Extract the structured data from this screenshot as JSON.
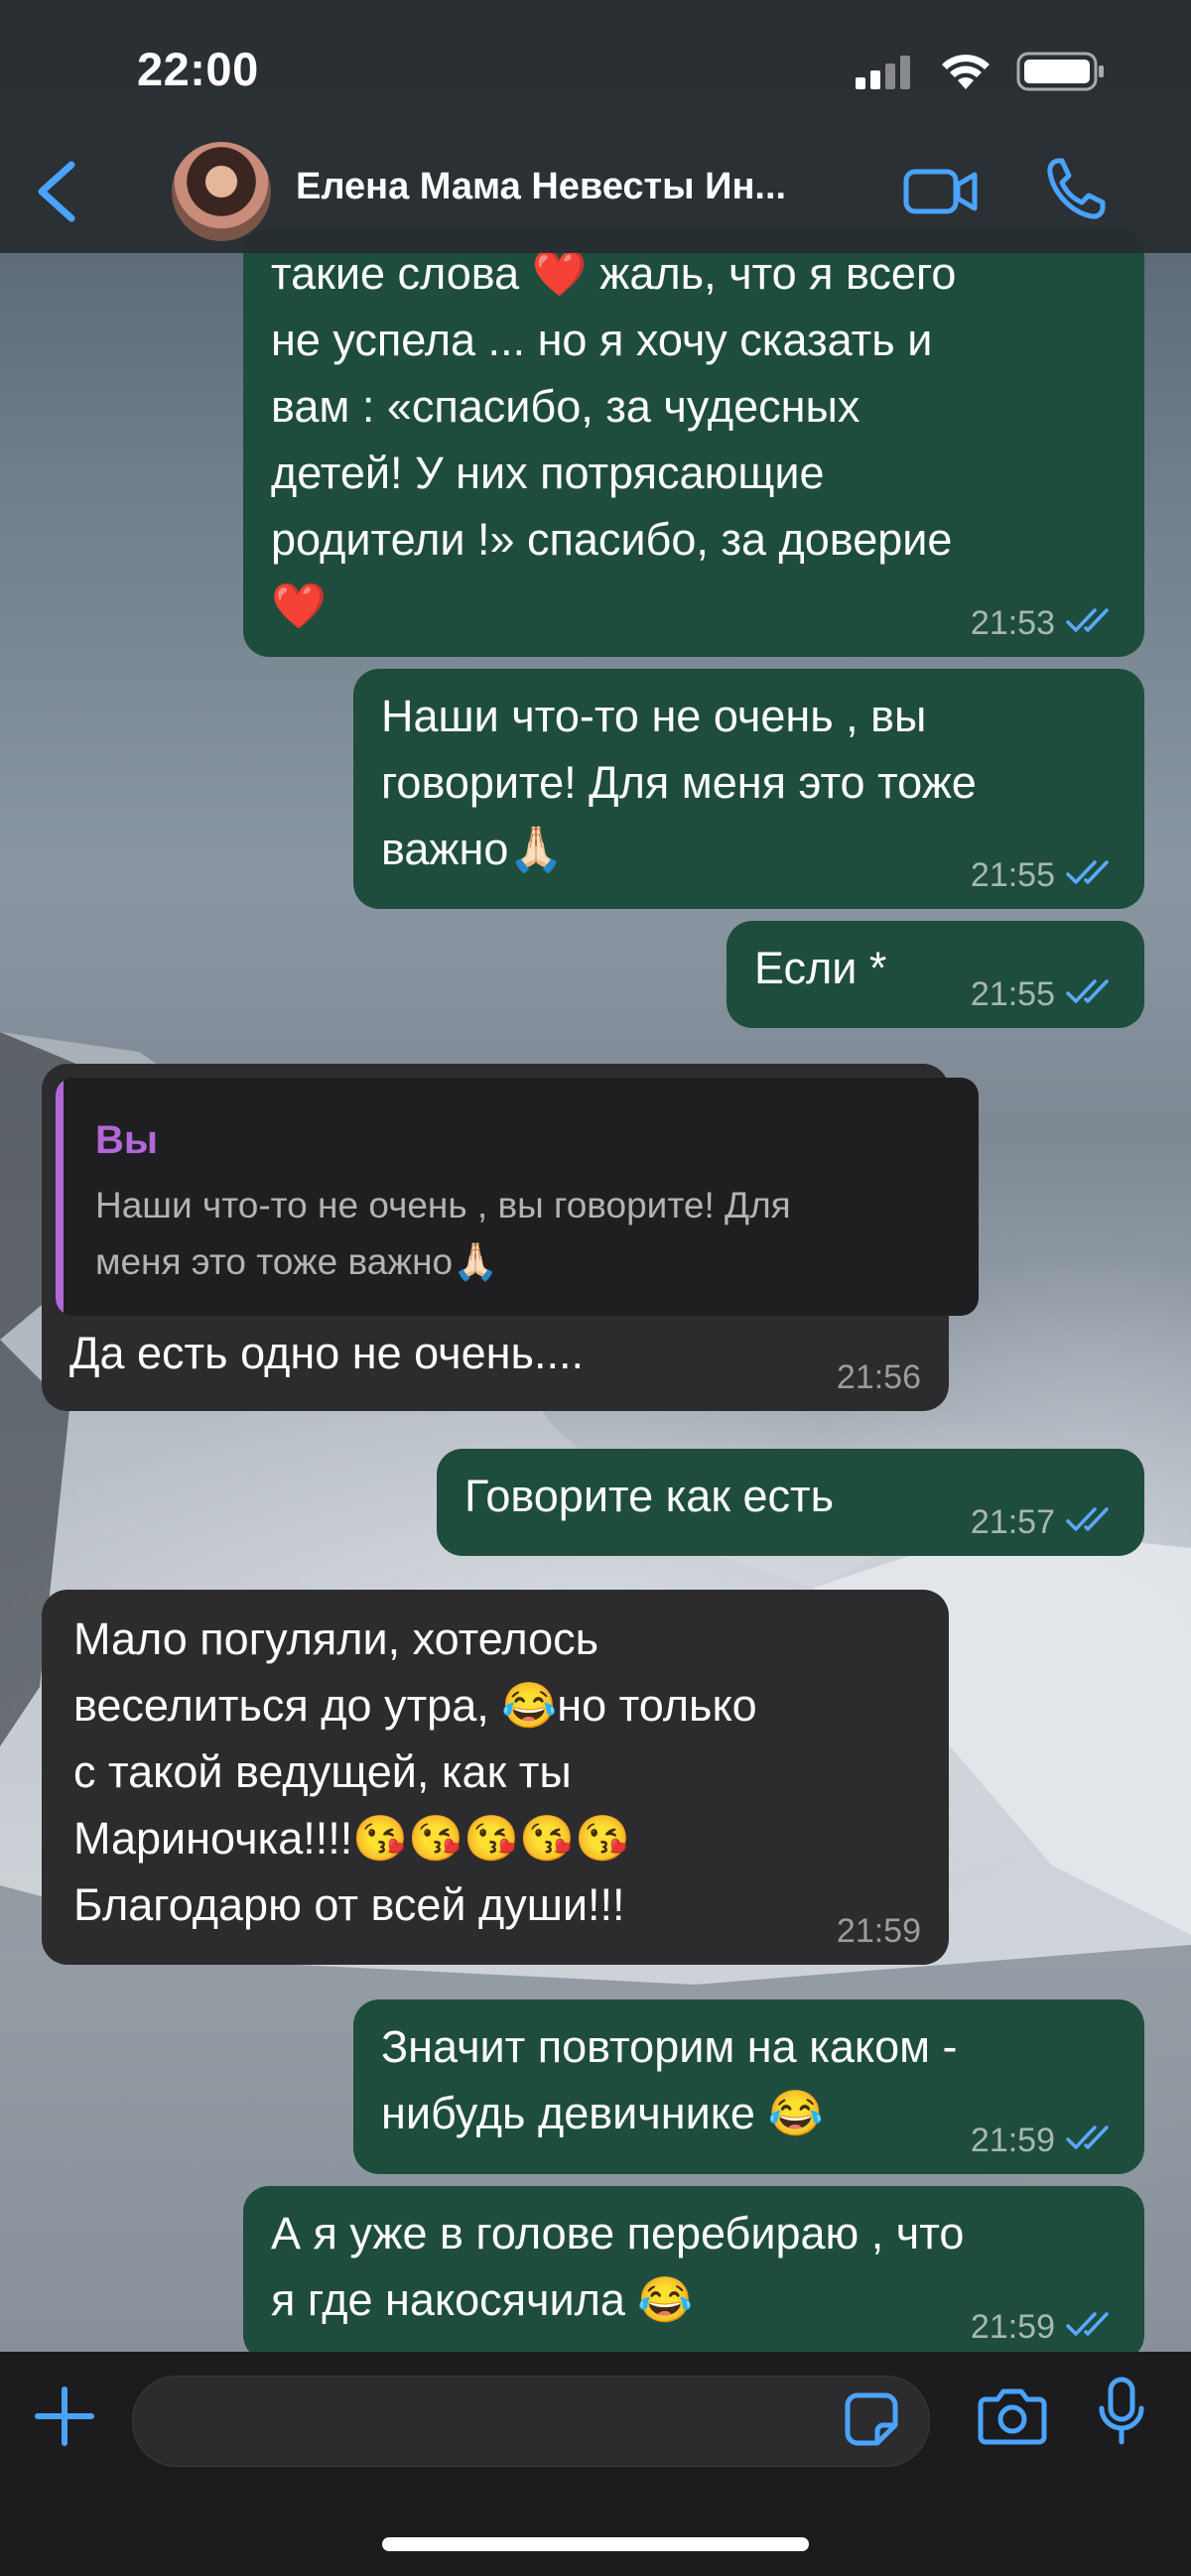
{
  "status_bar": {
    "time": "22:00"
  },
  "header": {
    "contact_name": "Елена Мама Невесты Ин..."
  },
  "messages": [
    {
      "dir": "out",
      "lines": [
        "такие слова ❤️ жаль, что я всего",
        "не успела ... но я хочу сказать и",
        "вам : «спасибо, за чудесных",
        "детей! У них потрясающие",
        "родители !» спасибо, за доверие",
        "❤️"
      ],
      "time": "21:53"
    },
    {
      "dir": "out",
      "lines": [
        "Наши что-то не очень , вы",
        "говорите! Для меня это тоже",
        "важно🙏🏻"
      ],
      "time": "21:55"
    },
    {
      "dir": "out",
      "lines": [
        "Если *"
      ],
      "time": "21:55"
    },
    {
      "dir": "in",
      "reply_author": "Вы",
      "reply_lines": [
        "Наши что-то не очень , вы говорите! Для",
        "меня это тоже важно🙏🏻"
      ],
      "lines": [
        "Да есть одно не очень...."
      ],
      "time": "21:56"
    },
    {
      "dir": "out",
      "lines": [
        "Говорите как есть"
      ],
      "time": "21:57"
    },
    {
      "dir": "in",
      "lines": [
        "Мало погуляли, хотелось",
        "веселиться до утра, 😂но только",
        "с такой ведущей, как ты",
        "Мариночка!!!!😘😘😘😘😘",
        "Благодарю от всей души!!!"
      ],
      "time": "21:59"
    },
    {
      "dir": "out",
      "lines": [
        "Значит повторим на каком -",
        "нибудь девичнике 😂"
      ],
      "time": "21:59"
    },
    {
      "dir": "out",
      "lines": [
        "А я уже в голове перебираю , что",
        "я где накосячила 😂"
      ],
      "time": "21:59"
    }
  ],
  "icons": {
    "back": "chevron-left-icon",
    "video": "video-camera-icon",
    "call": "phone-icon",
    "plus": "plus-icon",
    "sticker": "sticker-icon",
    "camera": "camera-icon",
    "mic": "microphone-icon"
  },
  "colors": {
    "accent": "#4aa3ff",
    "outgoing_bubble": "#1f4d3d",
    "incoming_bubble": "#2c2c2e",
    "reply_author": "#b267d7"
  }
}
